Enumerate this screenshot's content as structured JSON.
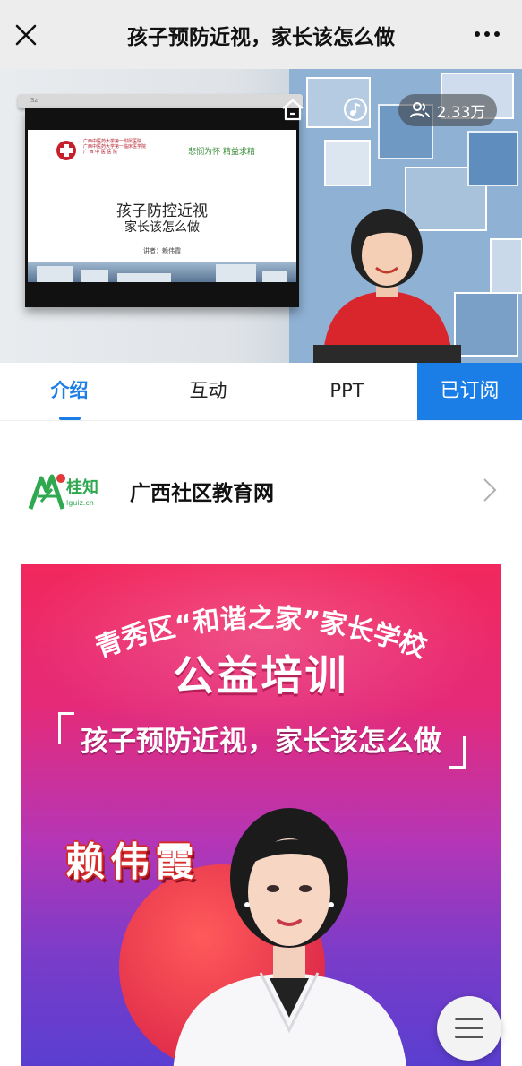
{
  "topbar": {
    "title": "孩子预防近视，家长该怎么做",
    "close_icon": "close-icon",
    "more_icon": "more-icon"
  },
  "video": {
    "viewers": "2.33万",
    "slide": {
      "title": "孩子防控近视",
      "subtitle": "家长该怎么做",
      "author": "讲者：赖伟霞",
      "slogan": "悲悯为怀  精益求精",
      "screen_brand": "Sz",
      "logo_lines": [
        "广西中医药大学第一附属医院",
        "广西中医药大学第一临床医学院",
        "广 西 中 医 医 院"
      ]
    }
  },
  "tabs": [
    {
      "label": "介绍",
      "active": true
    },
    {
      "label": "互动",
      "active": false
    },
    {
      "label": "PPT",
      "active": false
    }
  ],
  "subscribe": {
    "label": "已订阅"
  },
  "channel": {
    "name": "广西社区教育网",
    "logo_text": "桂知",
    "logo_url_text": "lguiz.cn"
  },
  "poster": {
    "arc_title": "青秀区“和谐之家”家长学校",
    "main_title": "公益培训",
    "topic": "孩子预防近视，家长该怎么做",
    "speaker": "赖伟霞"
  },
  "colors": {
    "accent": "#1a7ee6",
    "topbar_bg": "#ededed"
  }
}
